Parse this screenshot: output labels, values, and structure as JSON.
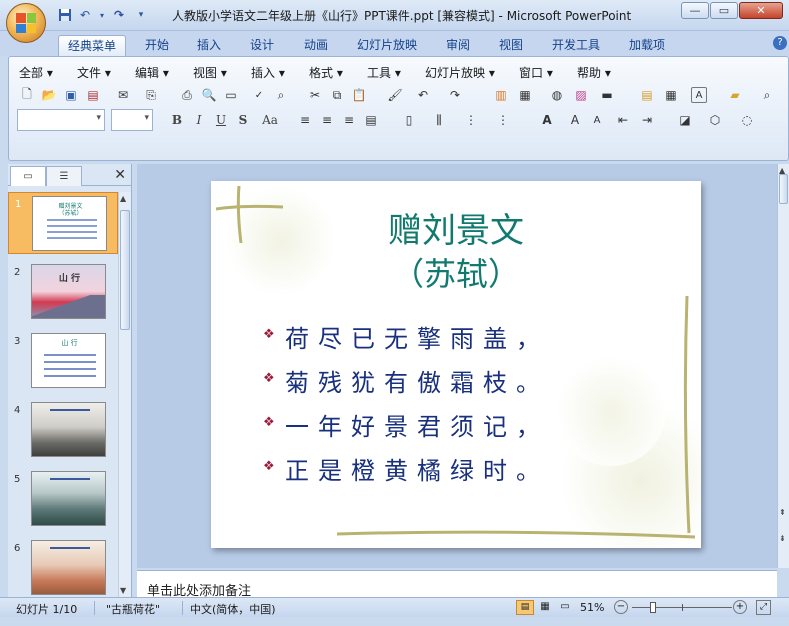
{
  "window": {
    "title": "人教版小学语文二年级上册《山行》PPT课件.ppt [兼容模式] - Microsoft PowerPoint",
    "controls": [
      "minimize",
      "maximize",
      "close"
    ]
  },
  "ribbon_tabs": [
    "经典菜单",
    "开始",
    "插入",
    "设计",
    "动画",
    "幻灯片放映",
    "审阅",
    "视图",
    "开发工具",
    "加载项"
  ],
  "classic_menu": [
    "全部",
    "文件",
    "编辑",
    "视图",
    "插入",
    "格式",
    "工具",
    "幻灯片放映",
    "窗口",
    "帮助"
  ],
  "format_buttons": [
    "B",
    "I",
    "U",
    "S",
    "Aa"
  ],
  "slide_thumbnails": [
    {
      "num": "1",
      "title": "赠刘景文\n（苏轼）",
      "selected": true
    },
    {
      "num": "2",
      "title": "山 行",
      "selected": false
    },
    {
      "num": "3",
      "title": "山 行",
      "selected": false
    },
    {
      "num": "4",
      "title": "",
      "selected": false
    },
    {
      "num": "5",
      "title": "",
      "selected": false
    },
    {
      "num": "6",
      "title": "",
      "selected": false
    }
  ],
  "slide": {
    "title_line1": "赠刘景文",
    "title_line2": "（苏轼）",
    "lines": [
      "荷尽已无擎雨盖，",
      "菊残犹有傲霜枝。",
      "一年好景君须记，",
      "正是橙黄橘绿时。"
    ],
    "bullet": "❖"
  },
  "notes_placeholder": "单击此处添加备注",
  "status": {
    "slide_info": "幻灯片 1/10",
    "theme": "\"古瓶荷花\"",
    "language": "中文(简体，中国)",
    "zoom": "51%"
  },
  "colors": {
    "title": "#117a6f",
    "body": "#18307d",
    "bullet": "#9b1b3e",
    "selected_thumb": "#f7bb62"
  }
}
